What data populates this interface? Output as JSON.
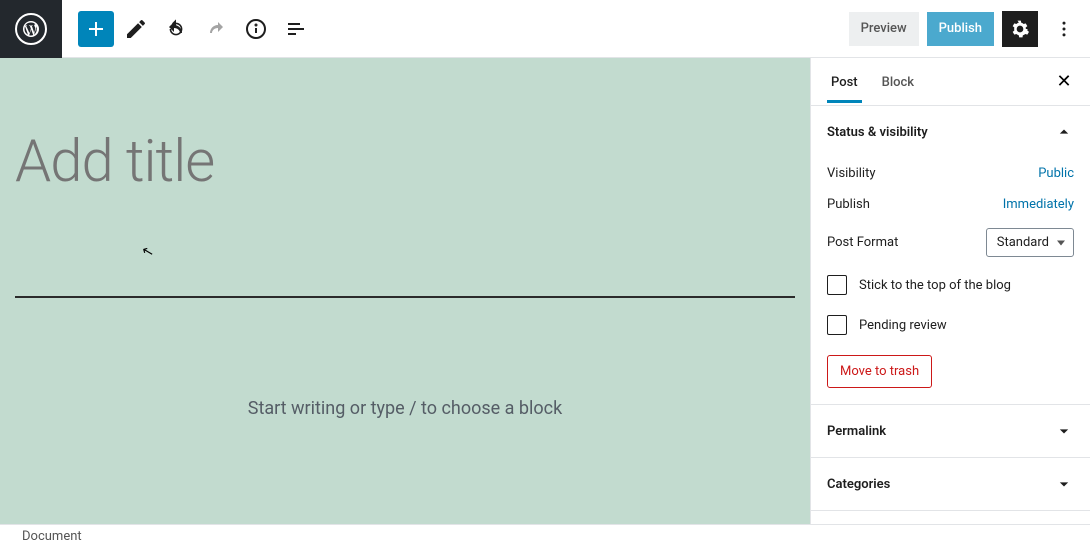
{
  "toolbar": {
    "preview_label": "Preview",
    "publish_label": "Publish"
  },
  "editor": {
    "title_placeholder": "Add title",
    "body_prompt": "Start writing or type / to choose a block"
  },
  "sidebar": {
    "tabs": {
      "post": "Post",
      "block": "Block"
    },
    "panels": {
      "status": {
        "heading": "Status & visibility",
        "visibility_label": "Visibility",
        "visibility_value": "Public",
        "publish_label": "Publish",
        "publish_value": "Immediately",
        "format_label": "Post Format",
        "format_value": "Standard",
        "stick_label": "Stick to the top of the blog",
        "pending_label": "Pending review",
        "trash_label": "Move to trash"
      },
      "permalink": {
        "heading": "Permalink"
      },
      "categories": {
        "heading": "Categories"
      }
    }
  },
  "footer": {
    "breadcrumb": "Document"
  }
}
